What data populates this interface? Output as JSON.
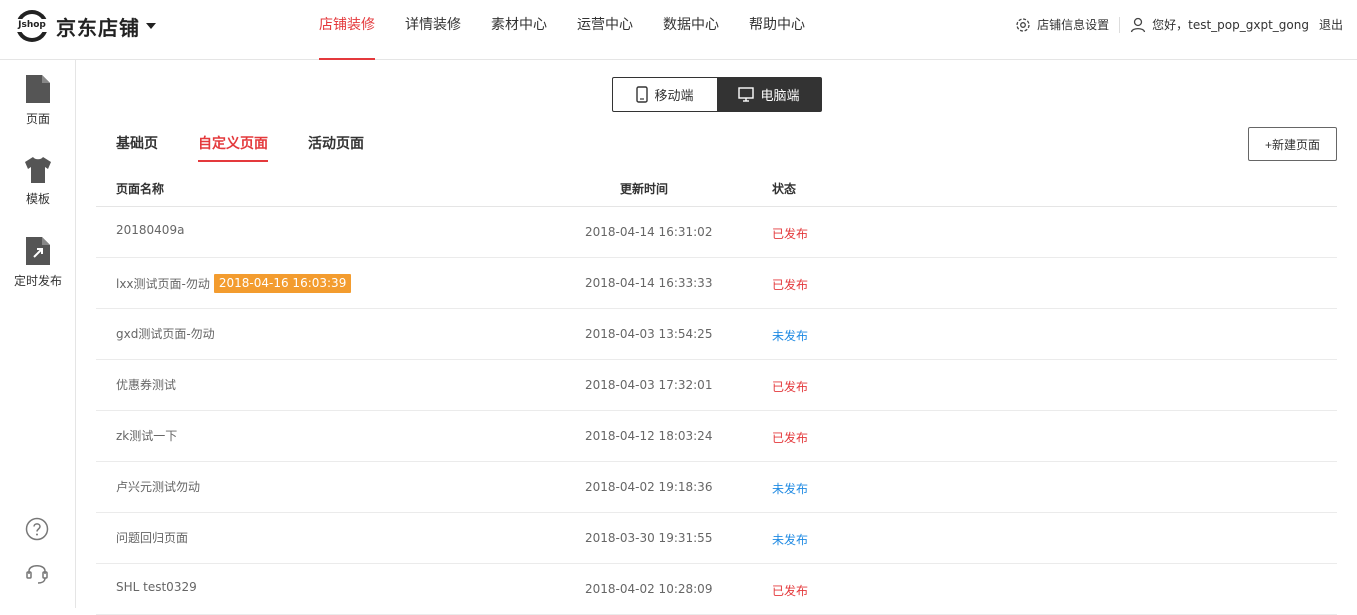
{
  "header": {
    "logo_text": "京东店铺",
    "logo_badge": "Jshop",
    "nav": [
      {
        "label": "店铺装修",
        "active": true
      },
      {
        "label": "详情装修",
        "active": false
      },
      {
        "label": "素材中心",
        "active": false
      },
      {
        "label": "运营中心",
        "active": false
      },
      {
        "label": "数据中心",
        "active": false
      },
      {
        "label": "帮助中心",
        "active": false
      }
    ],
    "settings_label": "店铺信息设置",
    "greeting": "您好，test_pop_gxpt_gong",
    "logout_label": "退出"
  },
  "sidebar": {
    "items": [
      {
        "label": "页面",
        "icon": "page-icon"
      },
      {
        "label": "模板",
        "icon": "shirt-icon"
      },
      {
        "label": "定时发布",
        "icon": "scheduled-publish-icon"
      }
    ],
    "bottom_icons": [
      "help-icon",
      "customer-service-icon"
    ]
  },
  "device_switcher": {
    "mobile_label": "移动端",
    "pc_label": "电脑端",
    "active": "pc"
  },
  "tabs": [
    {
      "label": "基础页",
      "active": false
    },
    {
      "label": "自定义页面",
      "active": true
    },
    {
      "label": "活动页面",
      "active": false
    }
  ],
  "new_page_label": "+新建页面",
  "table": {
    "columns": [
      "页面名称",
      "更新时间",
      "状态"
    ],
    "rows": [
      {
        "name": "20180409a",
        "badge": "",
        "time": "2018-04-14 16:31:02",
        "status": "已发布",
        "published": true
      },
      {
        "name": "lxx测试页面-勿动",
        "badge": "2018-04-16 16:03:39",
        "time": "2018-04-14 16:33:33",
        "status": "已发布",
        "published": true
      },
      {
        "name": "gxd测试页面-勿动",
        "badge": "",
        "time": "2018-04-03 13:54:25",
        "status": "未发布",
        "published": false
      },
      {
        "name": "优惠券测试",
        "badge": "",
        "time": "2018-04-03 17:32:01",
        "status": "已发布",
        "published": true
      },
      {
        "name": "zk测试一下",
        "badge": "",
        "time": "2018-04-12 18:03:24",
        "status": "已发布",
        "published": true
      },
      {
        "name": "卢兴元测试勿动",
        "badge": "",
        "time": "2018-04-02 19:18:36",
        "status": "未发布",
        "published": false
      },
      {
        "name": "问题回归页面",
        "badge": "",
        "time": "2018-03-30 19:31:55",
        "status": "未发布",
        "published": false
      },
      {
        "name": "SHL test0329",
        "badge": "",
        "time": "2018-04-02 10:28:09",
        "status": "已发布",
        "published": true
      }
    ]
  },
  "colors": {
    "accent": "#e4393c",
    "link_blue": "#1f8ae3",
    "badge_orange": "#f39c2f"
  }
}
